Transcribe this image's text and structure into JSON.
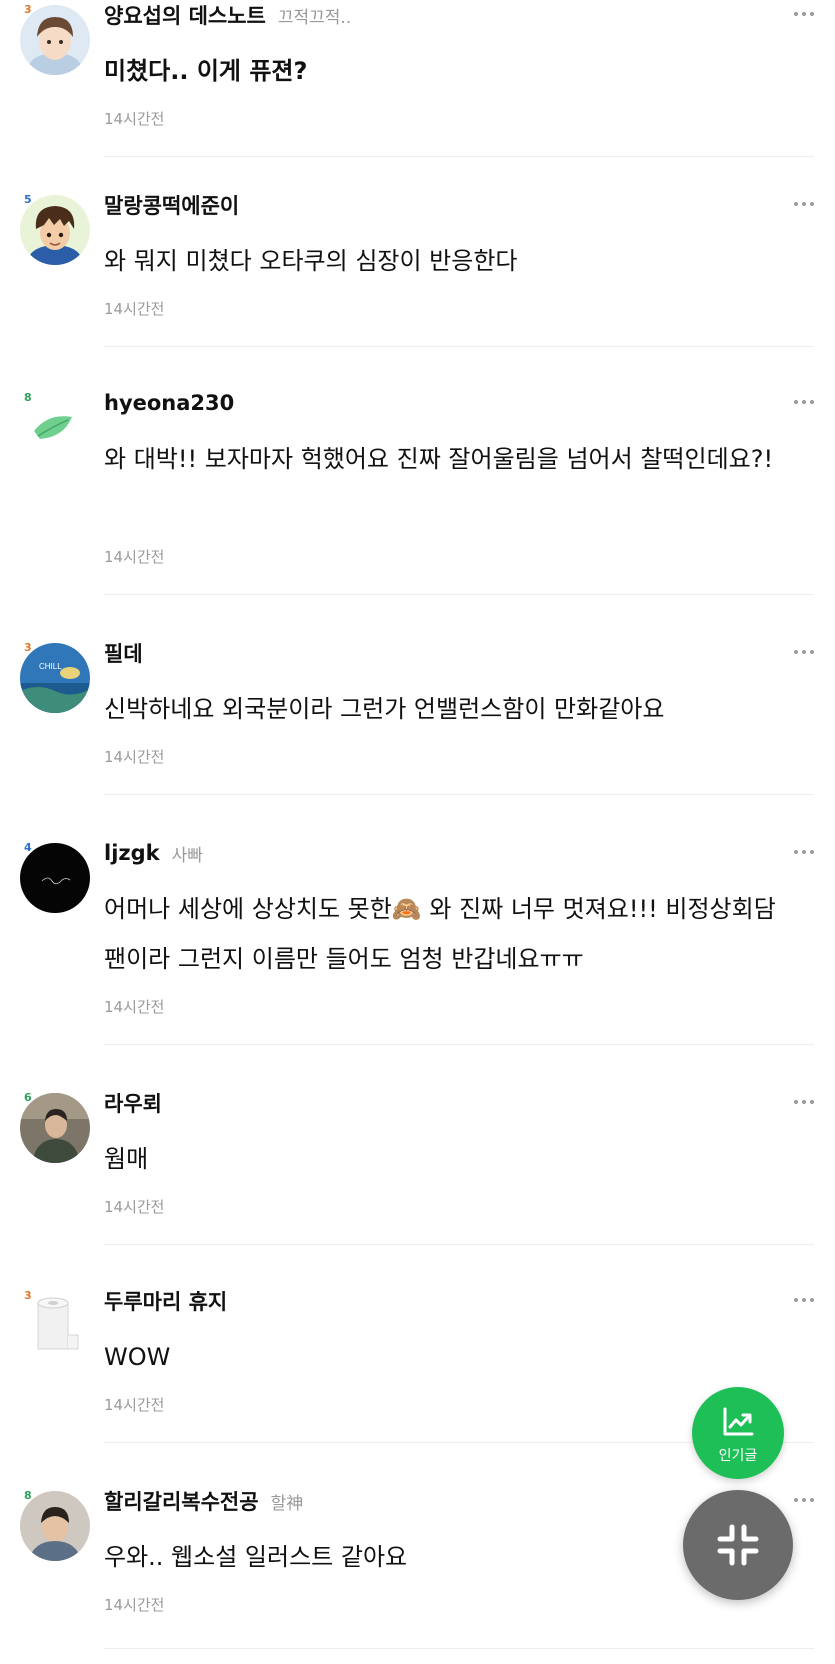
{
  "colors": {
    "accent_green": "#1fbf58",
    "fab_gray": "#6b6b6b",
    "text_primary": "#111111",
    "text_muted": "#9b9b9b",
    "divider": "#eeeeee"
  },
  "comments": [
    {
      "level": "3",
      "level_color": "#e07a2e",
      "avatar": "avatar-boy-illustration",
      "nickname": "양요섭의 데스노트",
      "tag": "끄적끄적..",
      "text": "미쳤다.. 이게 퓨젼?",
      "time": "14시간전"
    },
    {
      "level": "5",
      "level_color": "#2f6fd1",
      "avatar": "avatar-anime-boy",
      "nickname": "말랑콩떡에준이",
      "tag": "",
      "text": "와 뭐지 미쳤다 오타쿠의 심장이 반응한다",
      "time": "14시간전"
    },
    {
      "level": "8",
      "level_color": "#2fa05a",
      "avatar": "avatar-leaf",
      "nickname": "hyeona230",
      "tag": "",
      "text": "와 대박!! 보자마자 헉했어요 진짜 잘어울림을 넘어서 찰떡인데요?!",
      "time": "14시간전"
    },
    {
      "level": "3",
      "level_color": "#e07a2e",
      "avatar": "avatar-chill-ocean",
      "nickname": "필데",
      "tag": "",
      "text": "신박하네요 외국분이라 그런가 언밸런스함이 만화같아요",
      "time": "14시간전"
    },
    {
      "level": "4",
      "level_color": "#2f6fd1",
      "avatar": "avatar-black-signature",
      "nickname": "ljzgk",
      "tag": "사빠",
      "text": "어머나 세상에 상상치도 못한🙈 와 진짜 너무 멋져요!!! 비정상회담 팬이라 그런지 이름만 들어도 엄청 반갑네요ㅠㅠ",
      "time": "14시간전"
    },
    {
      "level": "6",
      "level_color": "#2fa05a",
      "avatar": "avatar-photo-man",
      "nickname": "라우뢰",
      "tag": "",
      "text": "웜매",
      "time": "14시간전"
    },
    {
      "level": "3",
      "level_color": "#e07a2e",
      "avatar": "avatar-toilet-paper",
      "nickname": "두루마리 휴지",
      "tag": "",
      "text": "WOW",
      "time": "14시간전"
    },
    {
      "level": "8",
      "level_color": "#2fa05a",
      "avatar": "avatar-photo-boy",
      "nickname": "할리갈리복수전공",
      "tag": "할神",
      "text": "우와.. 웹소설 일러스트 같아요",
      "time": "14시간전"
    }
  ],
  "fab_popular": {
    "label": "인기글",
    "icon": "trending-chart-icon"
  },
  "fab_collapse": {
    "icon": "collapse-icon"
  }
}
